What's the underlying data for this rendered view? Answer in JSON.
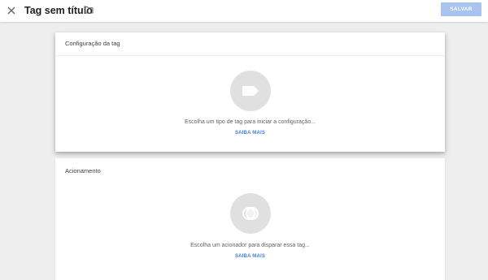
{
  "header": {
    "title": "Tag sem título",
    "close_icon": "close-icon",
    "folder_icon": "folder-icon",
    "save_label": "SALVAR",
    "save_color": "#a7c3ee"
  },
  "tag_config": {
    "title": "Configuração da tag",
    "icon": "tag-icon",
    "prompt": "Escolha um tipo de tag para iniciar a configuração...",
    "learn_more": "SAIBA MAIS"
  },
  "trigger": {
    "title": "Acionamento",
    "icon": "trigger-icon",
    "prompt": "Escolha um acionador para disparar essa tag...",
    "learn_more": "SAIBA MAIS"
  },
  "colors": {
    "background": "#eeeeee",
    "link": "#4a7fd6",
    "placeholder_circle": "#e0e0e0"
  }
}
